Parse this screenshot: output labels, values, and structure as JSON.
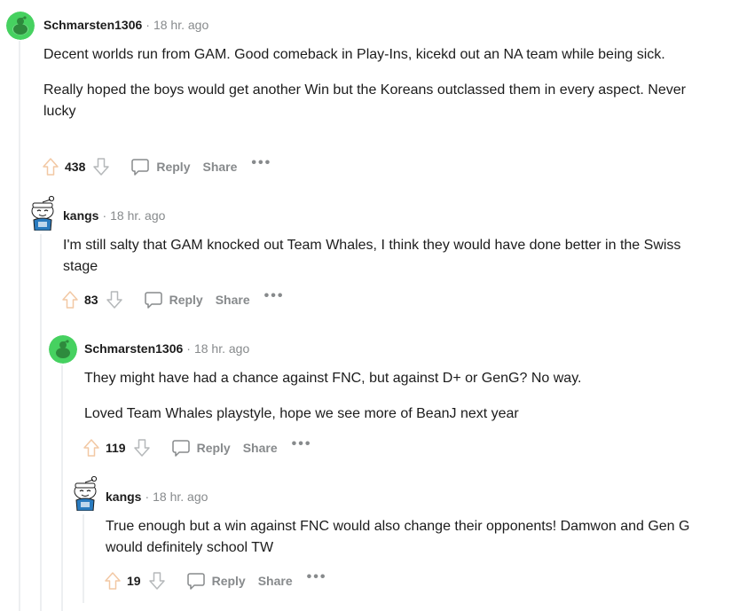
{
  "comments": [
    {
      "username": "Schmarsten1306",
      "time": "18 hr. ago",
      "avatar": "green-snoo-avatar",
      "paragraphs": [
        "Decent worlds run from GAM. Good comeback in Play-Ins, kicekd out an NA team while being sick.",
        "Really hoped the boys would get another Win but the Koreans outclassed them in every aspect. Never lucky"
      ],
      "score": "438",
      "reply": "Reply",
      "share": "Share",
      "more": "•••"
    },
    {
      "username": "kangs",
      "time": "18 hr. ago",
      "avatar": "sailor-snoo-avatar",
      "paragraphs": [
        "I'm still salty that GAM knocked out Team Whales, I think they would have done better in the Swiss stage"
      ],
      "score": "83",
      "reply": "Reply",
      "share": "Share",
      "more": "•••"
    },
    {
      "username": "Schmarsten1306",
      "time": "18 hr. ago",
      "avatar": "green-snoo-avatar",
      "paragraphs": [
        "They might have had a chance against FNC, but against D+ or GenG? No way.",
        "Loved Team Whales playstyle, hope we see more of BeanJ next year"
      ],
      "score": "119",
      "reply": "Reply",
      "share": "Share",
      "more": "•••"
    },
    {
      "username": "kangs",
      "time": "18 hr. ago",
      "avatar": "sailor-snoo-avatar",
      "paragraphs": [
        "True enough but a win against FNC would also change their opponents! Damwon and Gen G would definitely school TW"
      ],
      "score": "19",
      "reply": "Reply",
      "share": "Share",
      "more": "•••"
    }
  ],
  "colors": {
    "text": "#1c1c1c",
    "meta": "#878a8c",
    "thread_line": "#edeff1",
    "green_avatar": "#46d160"
  }
}
